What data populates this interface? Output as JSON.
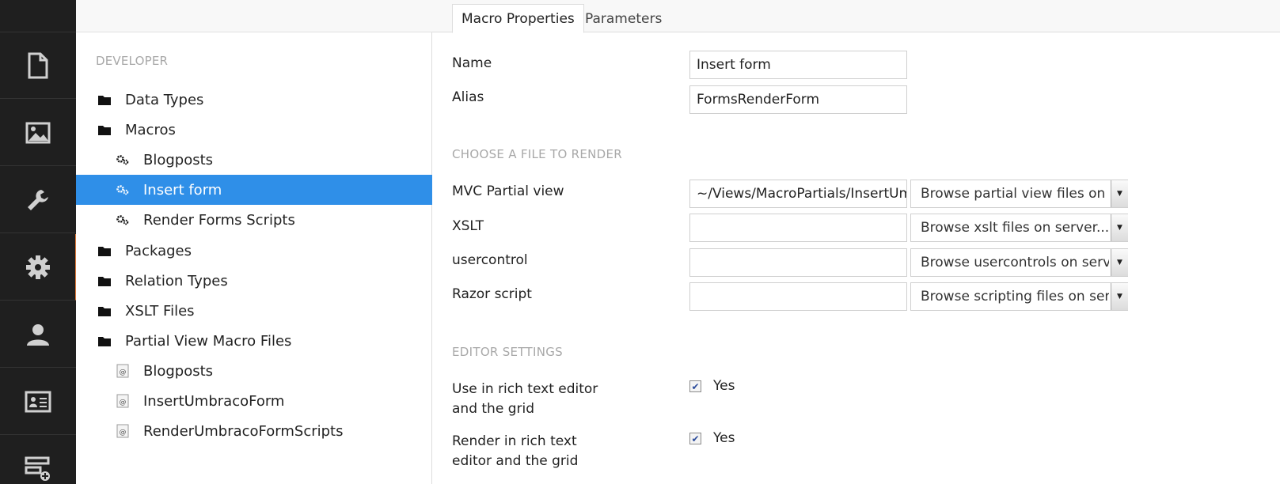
{
  "appbar": {
    "icons": [
      "document-icon",
      "image-icon",
      "wrench-icon",
      "gear-icon",
      "user-icon",
      "id-card-icon",
      "form-add-icon"
    ],
    "active_color": "#e07a3a"
  },
  "tree": {
    "section_title": "DEVELOPER",
    "items": [
      {
        "label": "Data Types",
        "icon": "folder-icon"
      },
      {
        "label": "Macros",
        "icon": "folder-icon"
      },
      {
        "label": "Blogposts",
        "icon": "cogs-icon"
      },
      {
        "label": "Insert form",
        "icon": "cogs-icon",
        "selected": true
      },
      {
        "label": "Render Forms Scripts",
        "icon": "cogs-icon"
      },
      {
        "label": "Packages",
        "icon": "folder-icon"
      },
      {
        "label": "Relation Types",
        "icon": "folder-icon"
      },
      {
        "label": "XSLT Files",
        "icon": "folder-icon"
      },
      {
        "label": "Partial View Macro Files",
        "icon": "folder-icon"
      },
      {
        "label": "Blogposts",
        "icon": "razor-file-icon"
      },
      {
        "label": "InsertUmbracoForm",
        "icon": "razor-file-icon"
      },
      {
        "label": "RenderUmbracoFormScripts",
        "icon": "razor-file-icon"
      }
    ],
    "selected_color": "#2f8fe8"
  },
  "tabs": {
    "macro_properties": "Macro Properties",
    "parameters": "Parameters"
  },
  "form": {
    "name_label": "Name",
    "name_value": "Insert form",
    "alias_label": "Alias",
    "alias_value": "FormsRenderForm",
    "file_section": "CHOOSE A FILE TO RENDER",
    "mvc_label": "MVC Partial view",
    "mvc_value": "~/Views/MacroPartials/InsertUmbracoForm.cshtml",
    "mvc_select": "Browse partial view files on server...",
    "xslt_label": "XSLT",
    "xslt_value": "",
    "xslt_select": "Browse xslt files on server...",
    "usercontrol_label": "usercontrol",
    "usercontrol_value": "",
    "usercontrol_select": "Browse usercontrols on server...",
    "razor_label": "Razor script",
    "razor_value": "",
    "razor_select": "Browse scripting files on server...",
    "editor_section": "EDITOR SETTINGS",
    "use_in_rte_label_1": "Use in rich text editor",
    "use_in_rte_label_2": "and the grid",
    "use_in_rte_value": "Yes",
    "render_in_rte_label_1": "Render in rich text",
    "render_in_rte_label_2": "editor and the grid",
    "render_in_rte_value": "Yes"
  }
}
